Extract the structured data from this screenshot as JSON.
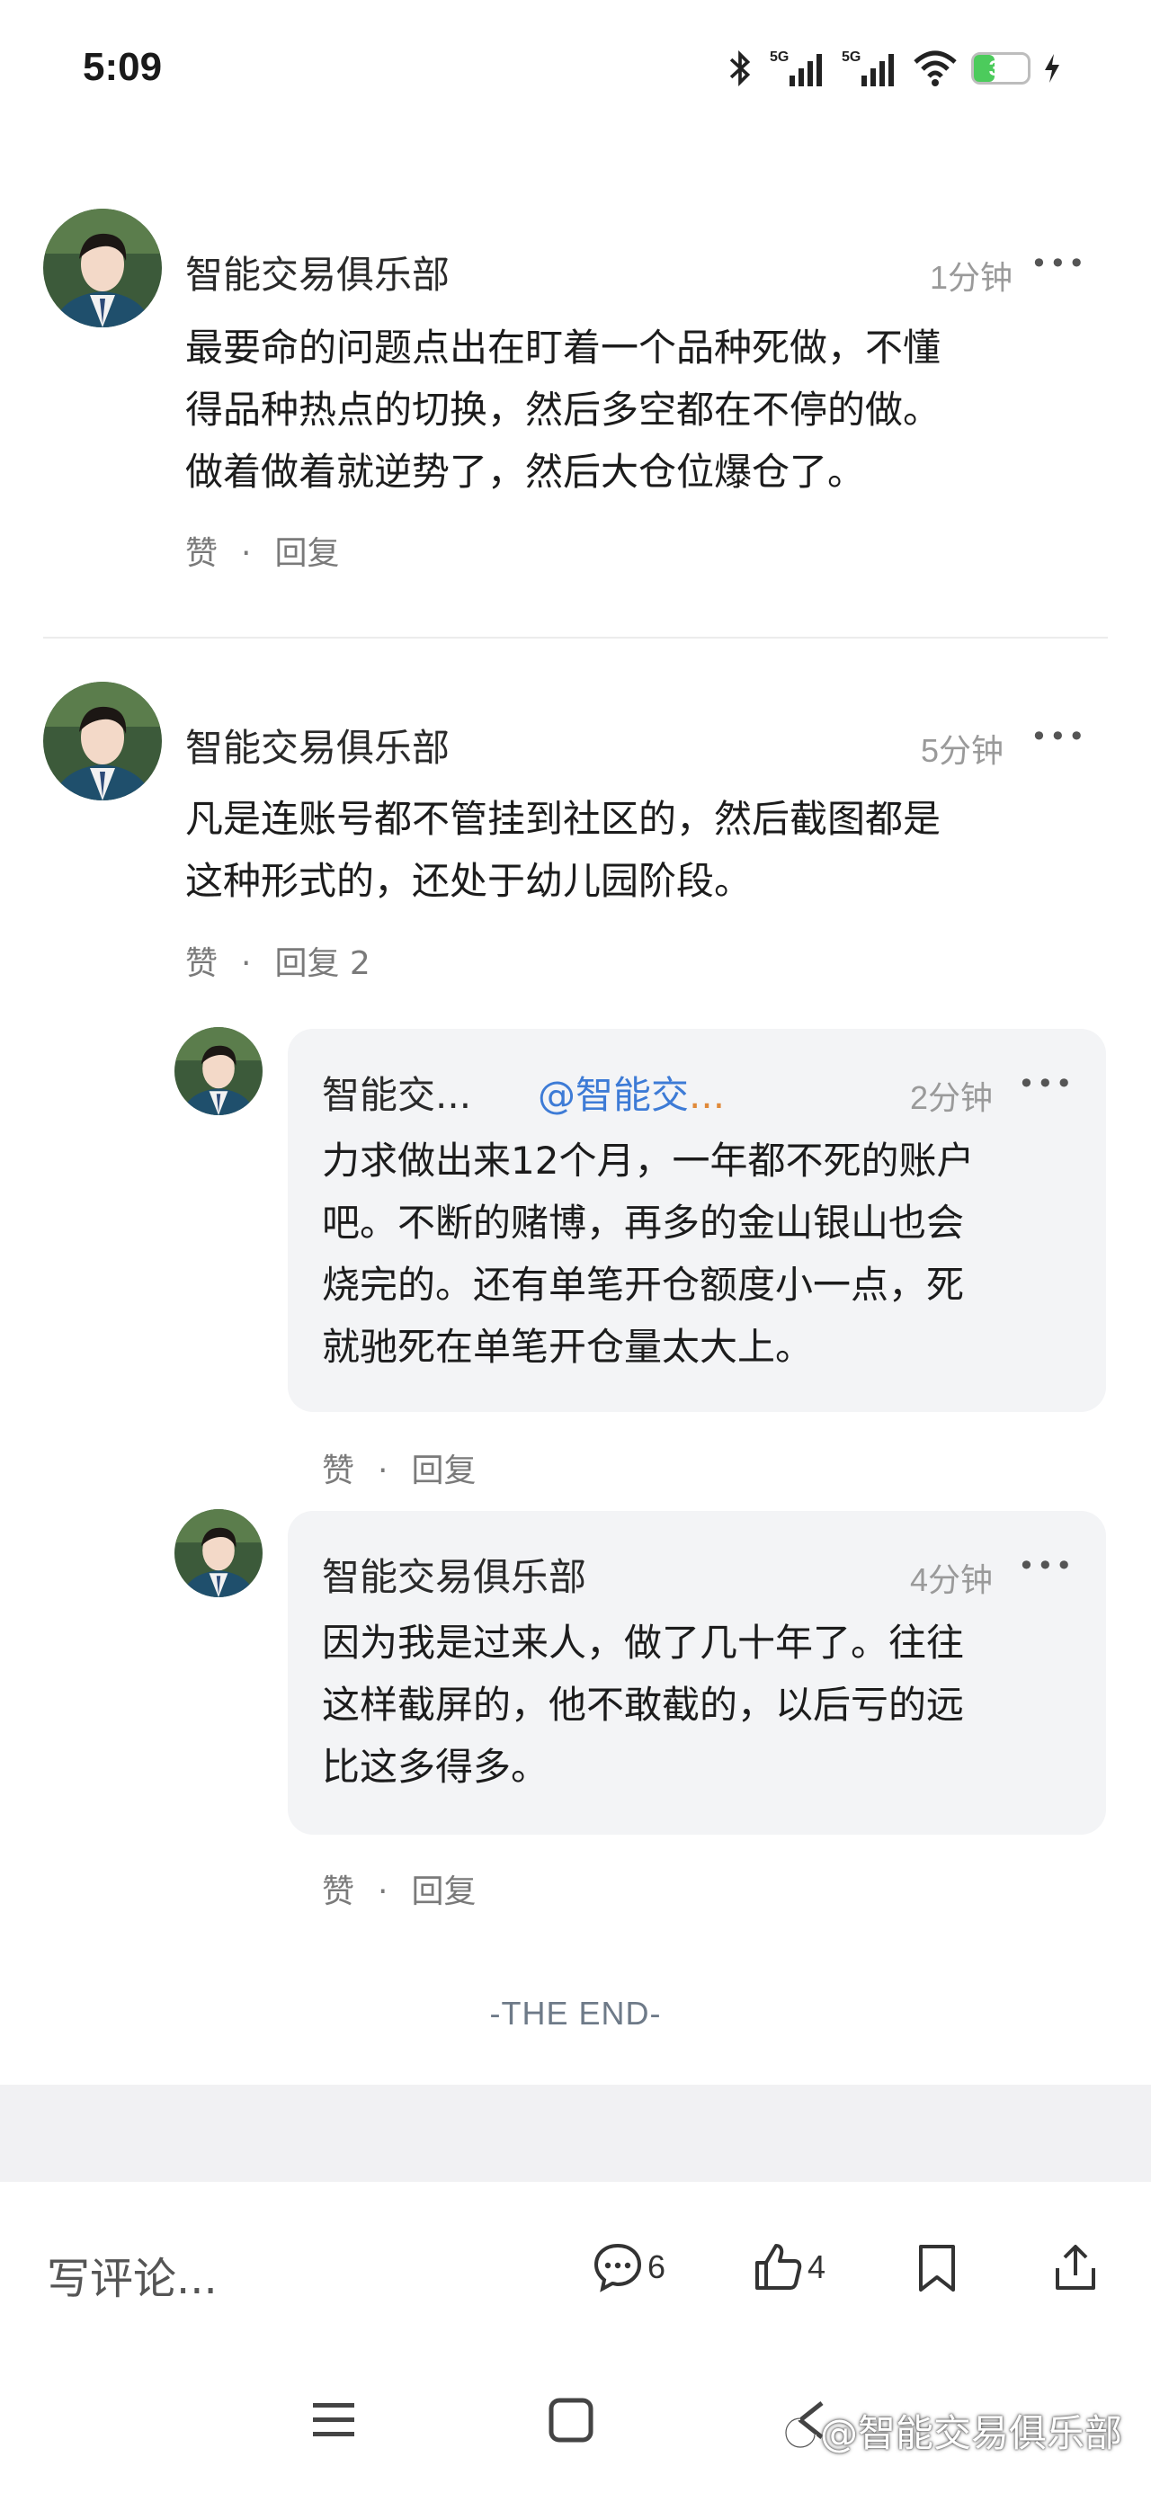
{
  "status_bar": {
    "time": "5:09",
    "battery": "39",
    "battery_level": 0.39,
    "network1": "5G",
    "network2": "5G"
  },
  "comments": [
    {
      "author": "智能交易俱乐部",
      "time": "1分钟",
      "lines": [
        "最要命的问题点出在盯着一个品种死做，不懂",
        "得品种热点的切换，然后多空都在不停的做。",
        "做着做着就逆势了，然后大仓位爆仓了。"
      ],
      "like": "赞",
      "reply": "回复"
    },
    {
      "author": "智能交易俱乐部",
      "time": "5分钟",
      "lines": [
        "凡是连账号都不管挂到社区的，然后截图都是",
        "这种形式的，还处于幼儿园阶段。"
      ],
      "like": "赞",
      "reply": "回复 2",
      "replies": [
        {
          "author": "智能交...",
          "mention": "@智能交",
          "mention_tail": "...",
          "time": "2分钟",
          "lines": [
            "力求做出来12个月，一年都不死的账户",
            "吧。不断的赌博，再多的金山银山也会",
            "烧完的。还有单笔开仓额度小一点，死",
            "就驰死在单笔开仓量太大上。"
          ],
          "like": "赞",
          "reply": "回复"
        },
        {
          "author": "智能交易俱乐部",
          "time": "4分钟",
          "lines": [
            "因为我是过来人，做了几十年了。往往",
            "这样截屏的，他不敢截的，以后亏的远",
            "比这多得多。"
          ],
          "like": "赞",
          "reply": "回复"
        }
      ]
    }
  ],
  "end_text": "-THE END-",
  "bottom_bar": {
    "write_placeholder": "写评论...",
    "comment_count": "6",
    "like_count": "4"
  },
  "watermark": "@智能交易俱乐部"
}
